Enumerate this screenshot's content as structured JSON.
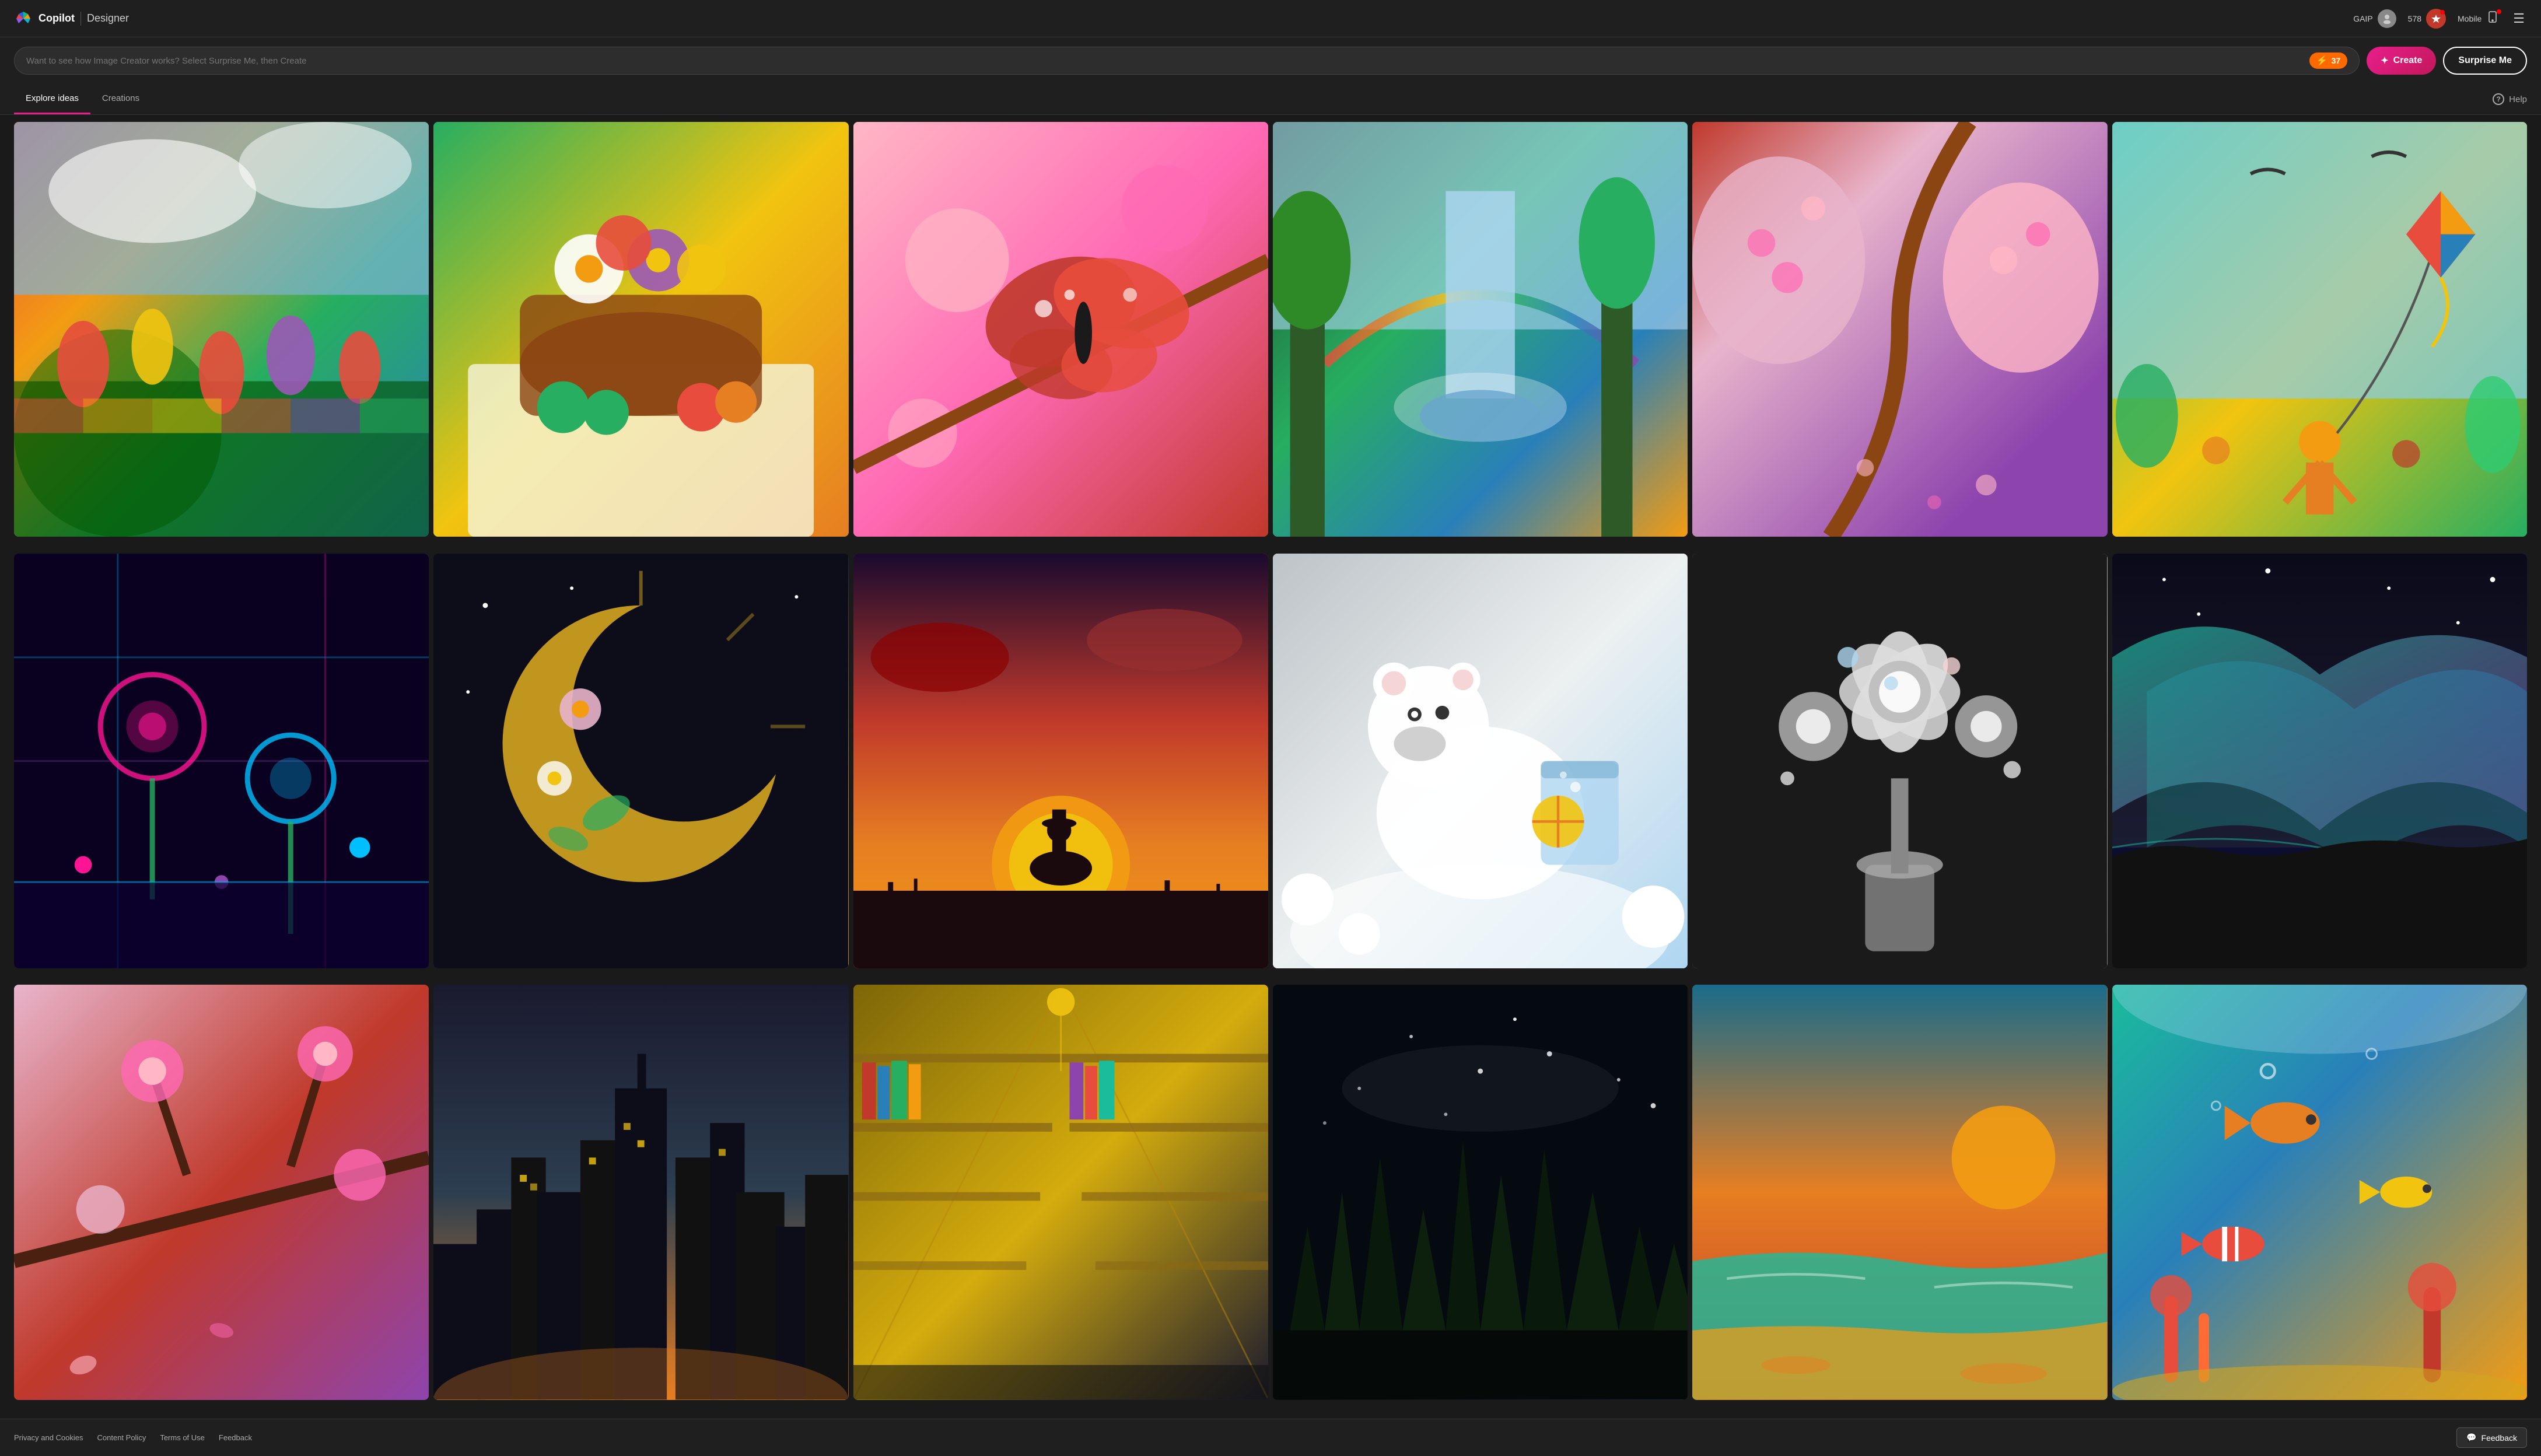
{
  "header": {
    "app_name": "Copilot",
    "divider": "|",
    "product_name": "Designer",
    "nav_items": [
      {
        "label": "GAIP",
        "type": "user"
      },
      {
        "label": "578",
        "type": "badge"
      },
      {
        "label": "Mobile",
        "type": "mobile"
      }
    ],
    "hamburger_label": "☰"
  },
  "search": {
    "placeholder": "Want to see how Image Creator works? Select Surprise Me, then Create",
    "boost_count": "37",
    "create_label": "Create",
    "create_icon": "✦",
    "surprise_label": "Surprise Me"
  },
  "tabs": [
    {
      "label": "Explore ideas",
      "active": true
    },
    {
      "label": "Creations",
      "active": false
    }
  ],
  "help": {
    "label": "Help",
    "icon": "?"
  },
  "images": [
    {
      "id": "tulips",
      "class": "img-tulips",
      "alt": "Tulip field with colorful rainbow stripes"
    },
    {
      "id": "flowers",
      "class": "img-flowers",
      "alt": "Basket of flowers with fruits"
    },
    {
      "id": "butterfly",
      "class": "img-butterfly",
      "alt": "Butterfly on cherry blossom"
    },
    {
      "id": "waterfall",
      "class": "img-waterfall",
      "alt": "Waterfall in lush forest with rainbow"
    },
    {
      "id": "cherry",
      "class": "img-cherry",
      "alt": "Cherry blossom trees in pink park"
    },
    {
      "id": "kite",
      "class": "img-kite",
      "alt": "Boy flying a kite in a park"
    },
    {
      "id": "neon",
      "class": "img-neon",
      "alt": "Neon cyberpunk flowers in blue"
    },
    {
      "id": "moon",
      "class": "img-moon",
      "alt": "Crescent moon with floral decoration"
    },
    {
      "id": "sunset",
      "class": "img-sunset",
      "alt": "Cowboy on horseback at sunset"
    },
    {
      "id": "polarbear",
      "class": "img-polarbear",
      "alt": "Polar bear with icy lemonade"
    },
    {
      "id": "jewel",
      "class": "img-jewel",
      "alt": "Jeweled diamond bouquet"
    },
    {
      "id": "aurora",
      "class": "img-aurora",
      "alt": "Aurora borealis over water"
    },
    {
      "id": "blossom",
      "class": "img-blossom",
      "alt": "Pink cherry blossom trees"
    },
    {
      "id": "citynight",
      "class": "img-citynight",
      "alt": "City skyline at night"
    },
    {
      "id": "library",
      "class": "img-library",
      "alt": "Grand library interior"
    },
    {
      "id": "forest",
      "class": "img-forest",
      "alt": "Dark starry forest"
    },
    {
      "id": "beach",
      "class": "img-beach",
      "alt": "Beach with warm sunset glow"
    },
    {
      "id": "underwater",
      "class": "img-underwater",
      "alt": "Underwater coral reef scene"
    }
  ],
  "footer": {
    "links": [
      {
        "label": "Privacy and Cookies"
      },
      {
        "label": "Content Policy"
      },
      {
        "label": "Terms of Use"
      },
      {
        "label": "Feedback"
      }
    ],
    "feedback_button": "Feedback",
    "feedback_icon": "💬"
  }
}
